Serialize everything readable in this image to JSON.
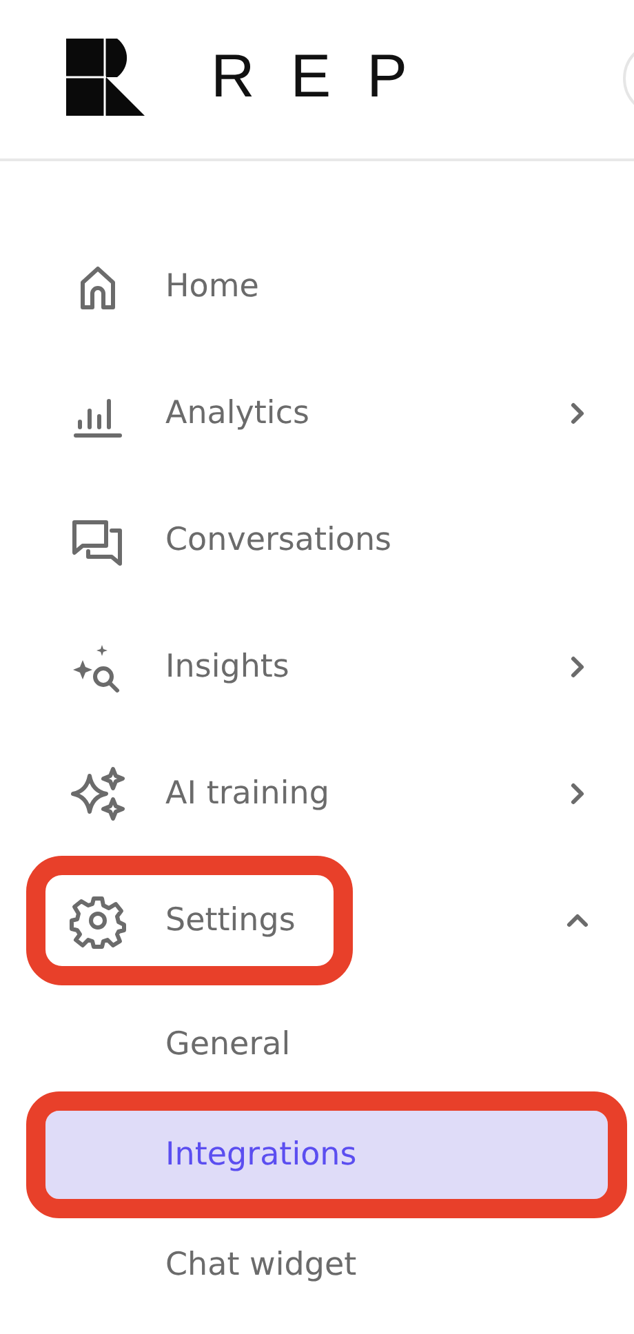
{
  "brand": {
    "name": "REP"
  },
  "nav": [
    {
      "label": "Home",
      "annotated": false
    },
    {
      "label": "Analytics",
      "expanded": false,
      "annotated": false
    },
    {
      "label": "Conversations",
      "annotated": false
    },
    {
      "label": "Insights",
      "expanded": false,
      "annotated": false
    },
    {
      "label": "AI training",
      "expanded": false,
      "annotated": false
    },
    {
      "label": "Settings",
      "expanded": true,
      "annotated": true,
      "children": [
        {
          "label": "General",
          "selected": false,
          "annotated": false
        },
        {
          "label": "Integrations",
          "selected": true,
          "annotated": true
        },
        {
          "label": "Chat widget",
          "selected": false,
          "annotated": false
        }
      ]
    }
  ]
}
